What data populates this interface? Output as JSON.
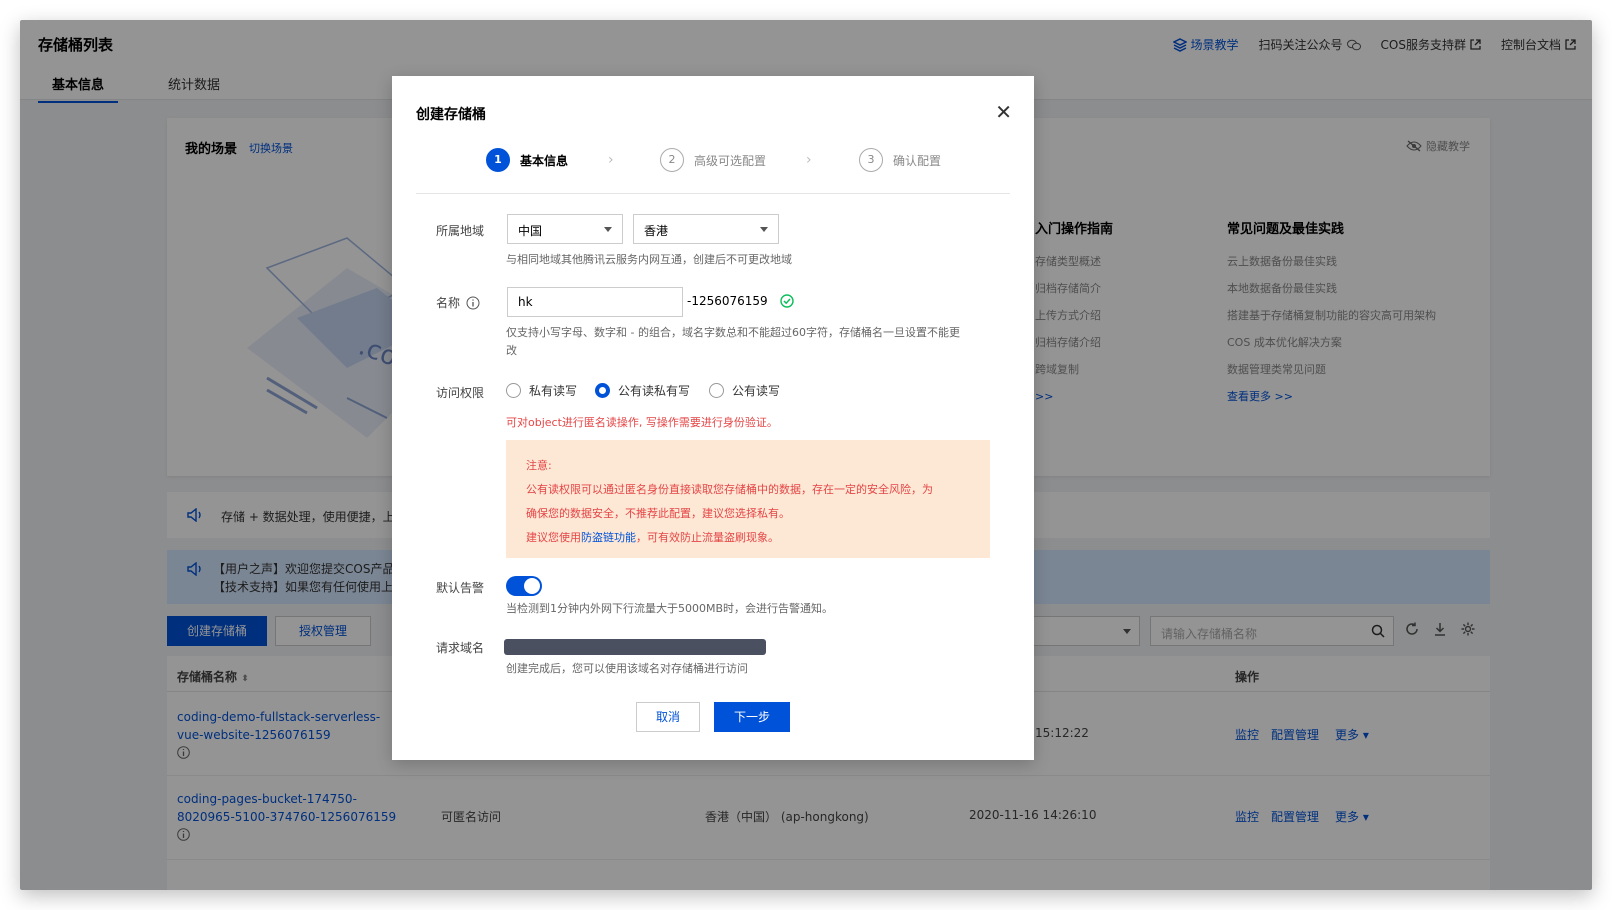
{
  "header": {
    "title": "存储桶列表",
    "links": [
      "场景教学",
      "扫码关注公众号",
      "COS服务支持群",
      "控制台文档"
    ],
    "tabs": [
      "基本信息",
      "统计数据"
    ]
  },
  "scene": {
    "title": "我的场景",
    "switch": "切换场景",
    "hide": "隐藏教学",
    "illus_text": ".com",
    "guide_title": "入门操作指南",
    "guide_items": [
      "存储类型概述",
      "归档存储简介",
      "上传方式介绍",
      "归档存储介绍",
      "跨域复制"
    ],
    "guide_more": ">>",
    "faq_title": "常见问题及最佳实践",
    "faq_items": [
      "云上数据备份最佳实践",
      "本地数据备份最佳实践",
      "搭建基于存储桶复制功能的容灾高可用架构",
      "COS 成本优化解决方案",
      "数据管理类常见问题"
    ],
    "faq_more": "查看更多 >>"
  },
  "notices": {
    "n1": "存储 + 数据处理，使用便捷，上云",
    "n2a": "【用户之声】欢迎您提交COS产品的",
    "n2b": "【技术支持】如果您有任何使用上的"
  },
  "toolbar": {
    "create": "创建存储桶",
    "auth": "授权管理",
    "search_placeholder": "请输入存储桶名称"
  },
  "table": {
    "col_name": "存储桶名称",
    "col_ops": "操作",
    "rows": [
      {
        "name": "coding-demo-fullstack-serverless-vue-website-1256076159",
        "access": "",
        "region": "",
        "time": "15:12:22",
        "ops": [
          "监控",
          "配置管理",
          "更多"
        ]
      },
      {
        "name": "coding-pages-bucket-174750-8020965-5100-374760-1256076159",
        "access": "可匿名访问",
        "region": "香港（中国） (ap-hongkong)",
        "time": "2020-11-16 14:26:10",
        "ops": [
          "监控",
          "配置管理",
          "更多"
        ]
      }
    ]
  },
  "modal": {
    "title": "创建存储桶",
    "steps": [
      {
        "num": "1",
        "label": "基本信息"
      },
      {
        "num": "2",
        "label": "高级可选配置"
      },
      {
        "num": "3",
        "label": "确认配置"
      }
    ],
    "region_label": "所属地域",
    "region_country": "中国",
    "region_city": "香港",
    "region_hint": "与相同地域其他腾讯云服务内网互通，创建后不可更改地域",
    "name_label": "名称",
    "name_value": "hk",
    "name_suffix": "-1256076159",
    "name_hint1": "仅支持小写字母、数字和 - 的组合，域名字数总和不能超过60字符，存储桶名一旦设置不能更",
    "name_hint2": "改",
    "access_label": "访问权限",
    "access_options": [
      "私有读写",
      "公有读私有写",
      "公有读写"
    ],
    "access_selected": "公有读私有写",
    "access_warn": "可对object进行匿名读操作, 写操作需要进行身份验证。",
    "note_title": "注意:",
    "note_line1": "公有读权限可以通过匿名身份直接读取您存储桶中的数据，存在一定的安全风险，为",
    "note_line2": "确保您的数据安全，不推荐此配置，建议您选择私有。",
    "note_line3_pre": "建议您使用",
    "note_line3_link": "防盗链功能",
    "note_line3_post": "，可有效防止流量盗刷现象。",
    "alarm_label": "默认告警",
    "alarm_on": true,
    "alarm_hint": "当检测到1分钟内外网下行流量大于5000MB时，会进行告警通知。",
    "domain_label": "请求域名",
    "domain_hint": "创建完成后，您可以使用该域名对存储桶进行访问",
    "cancel": "取消",
    "next": "下一步"
  },
  "colors": {
    "primary": "#0052d9",
    "warn": "#e54545",
    "note_bg": "#fde8d6"
  }
}
